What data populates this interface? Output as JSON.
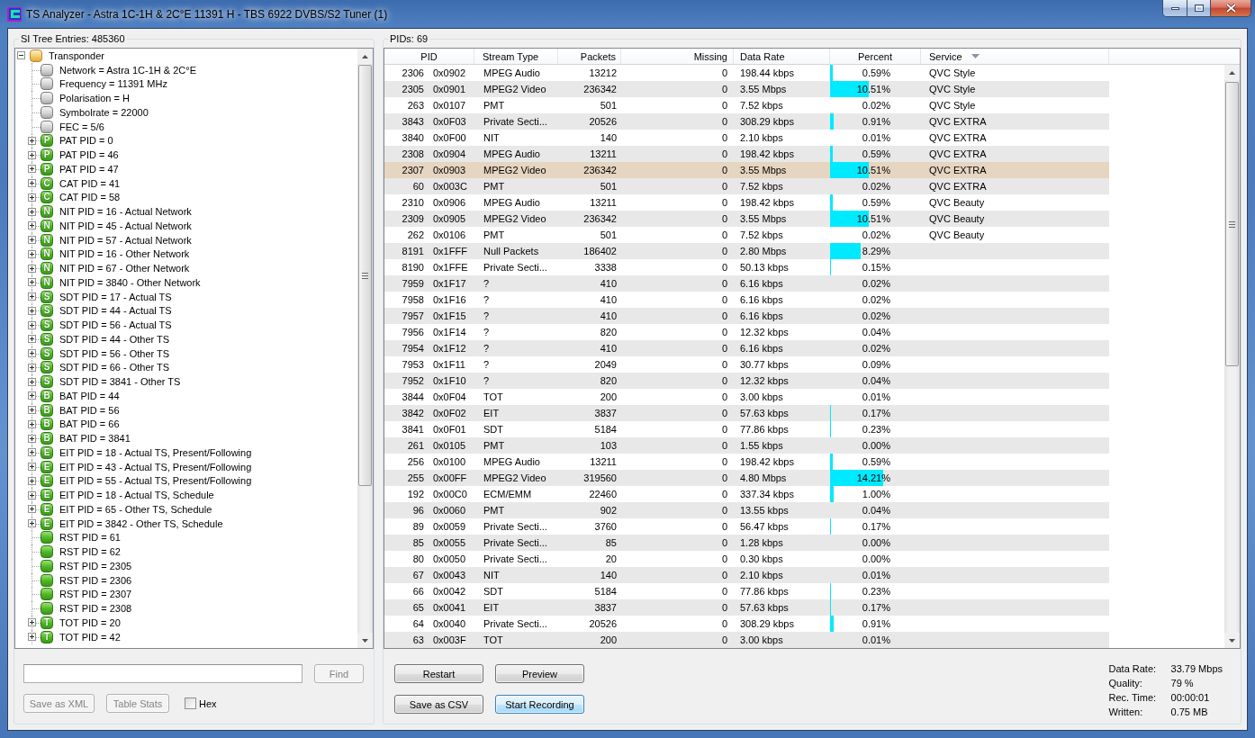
{
  "window": {
    "title": "TS Analyzer - Astra 1C-1H & 2C°E 11391 H - TBS 6922 DVBS/S2 Tuner (1)"
  },
  "si_tree": {
    "title": "SI Tree Entries: 485360",
    "nodes": [
      {
        "label": "Transponder",
        "kind": "root",
        "expanded": true,
        "children": [
          {
            "label": "Network = Astra 1C-1H & 2C°E",
            "kind": "param"
          },
          {
            "label": "Frequency = 11391 MHz",
            "kind": "param"
          },
          {
            "label": "Polarisation = H",
            "kind": "param"
          },
          {
            "label": "Symbolrate = 22000",
            "kind": "param"
          },
          {
            "label": "FEC = 5/6",
            "kind": "param"
          },
          {
            "label": "PAT PID = 0",
            "kind": "table",
            "badge": "P",
            "expanded": false
          },
          {
            "label": "PAT PID = 46",
            "kind": "table",
            "badge": "P",
            "expanded": false
          },
          {
            "label": "PAT PID = 47",
            "kind": "table",
            "badge": "P",
            "expanded": false
          },
          {
            "label": "CAT PID = 41",
            "kind": "table",
            "badge": "C",
            "expanded": false
          },
          {
            "label": "CAT PID = 58",
            "kind": "table",
            "badge": "C",
            "expanded": false
          },
          {
            "label": "NIT PID = 16 - Actual Network",
            "kind": "table",
            "badge": "N",
            "expanded": false
          },
          {
            "label": "NIT PID = 45 - Actual Network",
            "kind": "table",
            "badge": "N",
            "expanded": false
          },
          {
            "label": "NIT PID = 57 - Actual Network",
            "kind": "table",
            "badge": "N",
            "expanded": false
          },
          {
            "label": "NIT PID = 16 - Other Network",
            "kind": "table",
            "badge": "N",
            "expanded": false
          },
          {
            "label": "NIT PID = 67 - Other Network",
            "kind": "table",
            "badge": "N",
            "expanded": false
          },
          {
            "label": "NIT PID = 3840 - Other Network",
            "kind": "table",
            "badge": "N",
            "expanded": false
          },
          {
            "label": "SDT PID = 17 - Actual TS",
            "kind": "table",
            "badge": "S",
            "expanded": false
          },
          {
            "label": "SDT PID = 44 - Actual TS",
            "kind": "table",
            "badge": "S",
            "expanded": false
          },
          {
            "label": "SDT PID = 56 - Actual TS",
            "kind": "table",
            "badge": "S",
            "expanded": false
          },
          {
            "label": "SDT PID = 44 - Other TS",
            "kind": "table",
            "badge": "S",
            "expanded": false
          },
          {
            "label": "SDT PID = 56 - Other TS",
            "kind": "table",
            "badge": "S",
            "expanded": false
          },
          {
            "label": "SDT PID = 66 - Other TS",
            "kind": "table",
            "badge": "S",
            "expanded": false
          },
          {
            "label": "SDT PID = 3841 - Other TS",
            "kind": "table",
            "badge": "S",
            "expanded": false
          },
          {
            "label": "BAT PID = 44",
            "kind": "table",
            "badge": "B",
            "expanded": false
          },
          {
            "label": "BAT PID = 56",
            "kind": "table",
            "badge": "B",
            "expanded": false
          },
          {
            "label": "BAT PID = 66",
            "kind": "table",
            "badge": "B",
            "expanded": false
          },
          {
            "label": "BAT PID = 3841",
            "kind": "table",
            "badge": "B",
            "expanded": false
          },
          {
            "label": "EIT PID = 18 - Actual TS, Present/Following",
            "kind": "table",
            "badge": "E",
            "expanded": false
          },
          {
            "label": "EIT PID = 43 - Actual TS, Present/Following",
            "kind": "table",
            "badge": "E",
            "expanded": false
          },
          {
            "label": "EIT PID = 55 - Actual TS, Present/Following",
            "kind": "table",
            "badge": "E",
            "expanded": false
          },
          {
            "label": "EIT PID = 18 - Actual TS, Schedule",
            "kind": "table",
            "badge": "E",
            "expanded": false
          },
          {
            "label": "EIT PID = 65 - Other TS, Schedule",
            "kind": "table",
            "badge": "E",
            "expanded": false
          },
          {
            "label": "EIT PID = 3842 - Other TS, Schedule",
            "kind": "table",
            "badge": "E",
            "expanded": false
          },
          {
            "label": "RST PID = 61",
            "kind": "stream"
          },
          {
            "label": "RST PID = 62",
            "kind": "stream"
          },
          {
            "label": "RST PID = 2305",
            "kind": "stream"
          },
          {
            "label": "RST PID = 2306",
            "kind": "stream"
          },
          {
            "label": "RST PID = 2307",
            "kind": "stream"
          },
          {
            "label": "RST PID = 2308",
            "kind": "stream"
          },
          {
            "label": "TOT PID = 20",
            "kind": "table",
            "badge": "T",
            "expanded": false
          },
          {
            "label": "TOT PID = 42",
            "kind": "table",
            "badge": "T",
            "expanded": false
          }
        ]
      }
    ]
  },
  "tree_panel": {
    "find": {
      "label": "Find",
      "disabled": true
    },
    "buttons": [
      {
        "label": "Save as XML",
        "disabled": true
      },
      {
        "label": "Table Stats",
        "disabled": true
      }
    ],
    "hex": {
      "label": "Hex",
      "checked": false
    }
  },
  "pids": {
    "title": "PIDs: 69",
    "columns": [
      {
        "label": "PID",
        "sorted": false
      },
      {
        "label": "Stream Type",
        "sorted": false
      },
      {
        "label": "Packets",
        "sorted": false
      },
      {
        "label": "Missing",
        "sorted": false
      },
      {
        "label": "Data Rate",
        "sorted": false
      },
      {
        "label": "Percent",
        "sorted": false
      },
      {
        "label": "Service",
        "sorted": true
      }
    ],
    "rows": [
      {
        "pid": "2306",
        "hex": "0x0902",
        "stream_type": "MPEG Audio",
        "packets": "13212",
        "missing": "0",
        "data_rate": "198.44 kbps",
        "percent": "0.59%",
        "level": 0.025,
        "service": "QVC Style",
        "selected": false
      },
      {
        "pid": "2305",
        "hex": "0x0901",
        "stream_type": "MPEG2 Video",
        "packets": "236342",
        "missing": "0",
        "data_rate": "3.55 Mbps",
        "percent": "10.51%",
        "level": 0.43,
        "service": "QVC Style",
        "selected": false
      },
      {
        "pid": "263",
        "hex": "0x0107",
        "stream_type": "PMT",
        "packets": "501",
        "missing": "0",
        "data_rate": "7.52 kbps",
        "percent": "0.02%",
        "service": "QVC Style",
        "selected": false
      },
      {
        "pid": "3843",
        "hex": "0x0F03",
        "stream_type": "Private Secti...",
        "packets": "20526",
        "missing": "0",
        "data_rate": "308.29 kbps",
        "percent": "0.91%",
        "level": 0.04,
        "service": "QVC EXTRA",
        "selected": false
      },
      {
        "pid": "3840",
        "hex": "0x0F00",
        "stream_type": "NIT",
        "packets": "140",
        "missing": "0",
        "data_rate": "2.10 kbps",
        "percent": "0.01%",
        "service": "QVC EXTRA",
        "selected": false
      },
      {
        "pid": "2308",
        "hex": "0x0904",
        "stream_type": "MPEG Audio",
        "packets": "13211",
        "missing": "0",
        "data_rate": "198.42 kbps",
        "percent": "0.59%",
        "level": 0.025,
        "service": "QVC EXTRA",
        "selected": false
      },
      {
        "pid": "2307",
        "hex": "0x0903",
        "stream_type": "MPEG2 Video",
        "packets": "236342",
        "missing": "0",
        "data_rate": "3.55 Mbps",
        "percent": "10.51%",
        "level": 0.43,
        "service": "QVC EXTRA",
        "selected": true
      },
      {
        "pid": "60",
        "hex": "0x003C",
        "stream_type": "PMT",
        "packets": "501",
        "missing": "0",
        "data_rate": "7.52 kbps",
        "percent": "0.02%",
        "service": "QVC EXTRA",
        "selected": false
      },
      {
        "pid": "2310",
        "hex": "0x0906",
        "stream_type": "MPEG Audio",
        "packets": "13211",
        "missing": "0",
        "data_rate": "198.42 kbps",
        "percent": "0.59%",
        "level": 0.025,
        "service": "QVC Beauty",
        "selected": false
      },
      {
        "pid": "2309",
        "hex": "0x0905",
        "stream_type": "MPEG2 Video",
        "packets": "236342",
        "missing": "0",
        "data_rate": "3.55 Mbps",
        "percent": "10.51%",
        "level": 0.43,
        "service": "QVC Beauty",
        "selected": false
      },
      {
        "pid": "262",
        "hex": "0x0106",
        "stream_type": "PMT",
        "packets": "501",
        "missing": "0",
        "data_rate": "7.52 kbps",
        "percent": "0.02%",
        "service": "QVC Beauty",
        "selected": false
      },
      {
        "pid": "8191",
        "hex": "0x1FFF",
        "stream_type": "Null Packets",
        "packets": "186402",
        "missing": "0",
        "data_rate": "2.80 Mbps",
        "percent": "8.29%",
        "level": 0.34,
        "selected": false
      },
      {
        "pid": "8190",
        "hex": "0x1FFE",
        "stream_type": "Private Secti...",
        "packets": "3338",
        "missing": "0",
        "data_rate": "50.13 kbps",
        "percent": "0.15%",
        "level": 0.01,
        "selected": false
      },
      {
        "pid": "7959",
        "hex": "0x1F17",
        "stream_type": "?",
        "packets": "410",
        "missing": "0",
        "data_rate": "6.16 kbps",
        "percent": "0.02%",
        "selected": false
      },
      {
        "pid": "7958",
        "hex": "0x1F16",
        "stream_type": "?",
        "packets": "410",
        "missing": "0",
        "data_rate": "6.16 kbps",
        "percent": "0.02%",
        "selected": false
      },
      {
        "pid": "7957",
        "hex": "0x1F15",
        "stream_type": "?",
        "packets": "410",
        "missing": "0",
        "data_rate": "6.16 kbps",
        "percent": "0.02%",
        "selected": false
      },
      {
        "pid": "7956",
        "hex": "0x1F14",
        "stream_type": "?",
        "packets": "820",
        "missing": "0",
        "data_rate": "12.32 kbps",
        "percent": "0.04%",
        "selected": false
      },
      {
        "pid": "7954",
        "hex": "0x1F12",
        "stream_type": "?",
        "packets": "410",
        "missing": "0",
        "data_rate": "6.16 kbps",
        "percent": "0.02%",
        "selected": false
      },
      {
        "pid": "7953",
        "hex": "0x1F11",
        "stream_type": "?",
        "packets": "2049",
        "missing": "0",
        "data_rate": "30.77 kbps",
        "percent": "0.09%",
        "selected": false
      },
      {
        "pid": "7952",
        "hex": "0x1F10",
        "stream_type": "?",
        "packets": "820",
        "missing": "0",
        "data_rate": "12.32 kbps",
        "percent": "0.04%",
        "selected": false
      },
      {
        "pid": "3844",
        "hex": "0x0F04",
        "stream_type": "TOT",
        "packets": "200",
        "missing": "0",
        "data_rate": "3.00 kbps",
        "percent": "0.01%",
        "selected": false
      },
      {
        "pid": "3842",
        "hex": "0x0F02",
        "stream_type": "EIT",
        "packets": "3837",
        "missing": "0",
        "data_rate": "57.63 kbps",
        "percent": "0.17%",
        "level": 0.01,
        "selected": false
      },
      {
        "pid": "3841",
        "hex": "0x0F01",
        "stream_type": "SDT",
        "packets": "5184",
        "missing": "0",
        "data_rate": "77.86 kbps",
        "percent": "0.23%",
        "level": 0.01,
        "selected": false
      },
      {
        "pid": "261",
        "hex": "0x0105",
        "stream_type": "PMT",
        "packets": "103",
        "missing": "0",
        "data_rate": "1.55 kbps",
        "percent": "0.00%",
        "selected": false
      },
      {
        "pid": "256",
        "hex": "0x0100",
        "stream_type": "MPEG Audio",
        "packets": "13211",
        "missing": "0",
        "data_rate": "198.42 kbps",
        "percent": "0.59%",
        "level": 0.025,
        "selected": false
      },
      {
        "pid": "255",
        "hex": "0x00FF",
        "stream_type": "MPEG2 Video",
        "packets": "319560",
        "missing": "0",
        "data_rate": "4.80 Mbps",
        "percent": "14.21%",
        "level": 0.58,
        "selected": false
      },
      {
        "pid": "192",
        "hex": "0x00C0",
        "stream_type": "ECM/EMM",
        "packets": "22460",
        "missing": "0",
        "data_rate": "337.34 kbps",
        "percent": "1.00%",
        "level": 0.04,
        "selected": false
      },
      {
        "pid": "96",
        "hex": "0x0060",
        "stream_type": "PMT",
        "packets": "902",
        "missing": "0",
        "data_rate": "13.55 kbps",
        "percent": "0.04%",
        "selected": false
      },
      {
        "pid": "89",
        "hex": "0x0059",
        "stream_type": "Private Secti...",
        "packets": "3760",
        "missing": "0",
        "data_rate": "56.47 kbps",
        "percent": "0.17%",
        "level": 0.01,
        "selected": false
      },
      {
        "pid": "85",
        "hex": "0x0055",
        "stream_type": "Private Secti...",
        "packets": "85",
        "missing": "0",
        "data_rate": "1.28 kbps",
        "percent": "0.00%",
        "selected": false
      },
      {
        "pid": "80",
        "hex": "0x0050",
        "stream_type": "Private Secti...",
        "packets": "20",
        "missing": "0",
        "data_rate": "0.30 kbps",
        "percent": "0.00%",
        "selected": false
      },
      {
        "pid": "67",
        "hex": "0x0043",
        "stream_type": "NIT",
        "packets": "140",
        "missing": "0",
        "data_rate": "2.10 kbps",
        "percent": "0.01%",
        "selected": false
      },
      {
        "pid": "66",
        "hex": "0x0042",
        "stream_type": "SDT",
        "packets": "5184",
        "missing": "0",
        "data_rate": "77.86 kbps",
        "percent": "0.23%",
        "level": 0.01,
        "selected": false
      },
      {
        "pid": "65",
        "hex": "0x0041",
        "stream_type": "EIT",
        "packets": "3837",
        "missing": "0",
        "data_rate": "57.63 kbps",
        "percent": "0.17%",
        "level": 0.01,
        "selected": false
      },
      {
        "pid": "64",
        "hex": "0x0040",
        "stream_type": "Private Secti...",
        "packets": "20526",
        "missing": "0",
        "data_rate": "308.29 kbps",
        "percent": "0.91%",
        "level": 0.04,
        "selected": false
      },
      {
        "pid": "63",
        "hex": "0x003F",
        "stream_type": "TOT",
        "packets": "200",
        "missing": "0",
        "data_rate": "3.00 kbps",
        "percent": "0.01%",
        "selected": false
      }
    ]
  },
  "pid_panel": {
    "buttons": [
      {
        "label": "Restart",
        "disabled": false,
        "focused": false
      },
      {
        "label": "Preview",
        "disabled": false,
        "focused": false
      },
      {
        "label": "Save as CSV",
        "disabled": false,
        "focused": false
      },
      {
        "label": "Start Recording",
        "disabled": false,
        "focused": true
      }
    ],
    "stats": [
      {
        "label": "Data Rate:",
        "value": "33.79 Mbps"
      },
      {
        "label": "Quality:",
        "value": "79 %"
      },
      {
        "label": "Rec. Time:",
        "value": "00:00:01"
      },
      {
        "label": "Written:",
        "value": "0.75 MB"
      }
    ]
  }
}
